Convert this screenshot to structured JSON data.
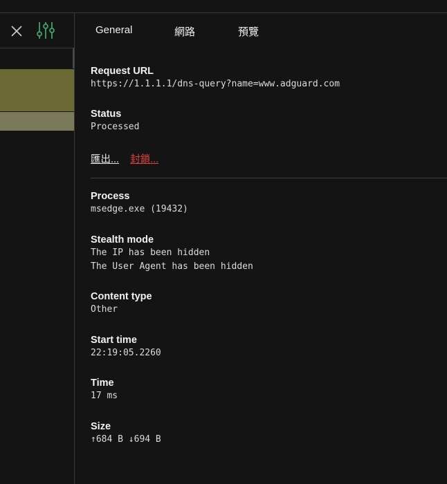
{
  "tabs": [
    "General",
    "網路",
    "預覽"
  ],
  "request": {
    "url_label": "Request URL",
    "url_value": "https://1.1.1.1/dns-query?name=www.adguard.com",
    "status_label": "Status",
    "status_value": "Processed"
  },
  "actions": {
    "export_label": "匯出...",
    "block_label": "封鎖..."
  },
  "details": {
    "process_label": "Process",
    "process_value": "msedge.exe (19432)",
    "stealth_label": "Stealth mode",
    "stealth_values": [
      "The IP has been hidden",
      "The User Agent has been hidden"
    ],
    "content_label": "Content type",
    "content_value": "Other",
    "start_label": "Start time",
    "start_value": "22:19:05.2260",
    "time_label": "Time",
    "time_value": "17 ms",
    "size_label": "Size",
    "size_value": "↑684 B ↓694 B"
  },
  "colors": {
    "accent_green": "#3fa36a",
    "selected_row": "#6b6a35",
    "block_red": "#e0443a"
  },
  "icons": [
    "close-icon",
    "filter-sliders-icon"
  ]
}
